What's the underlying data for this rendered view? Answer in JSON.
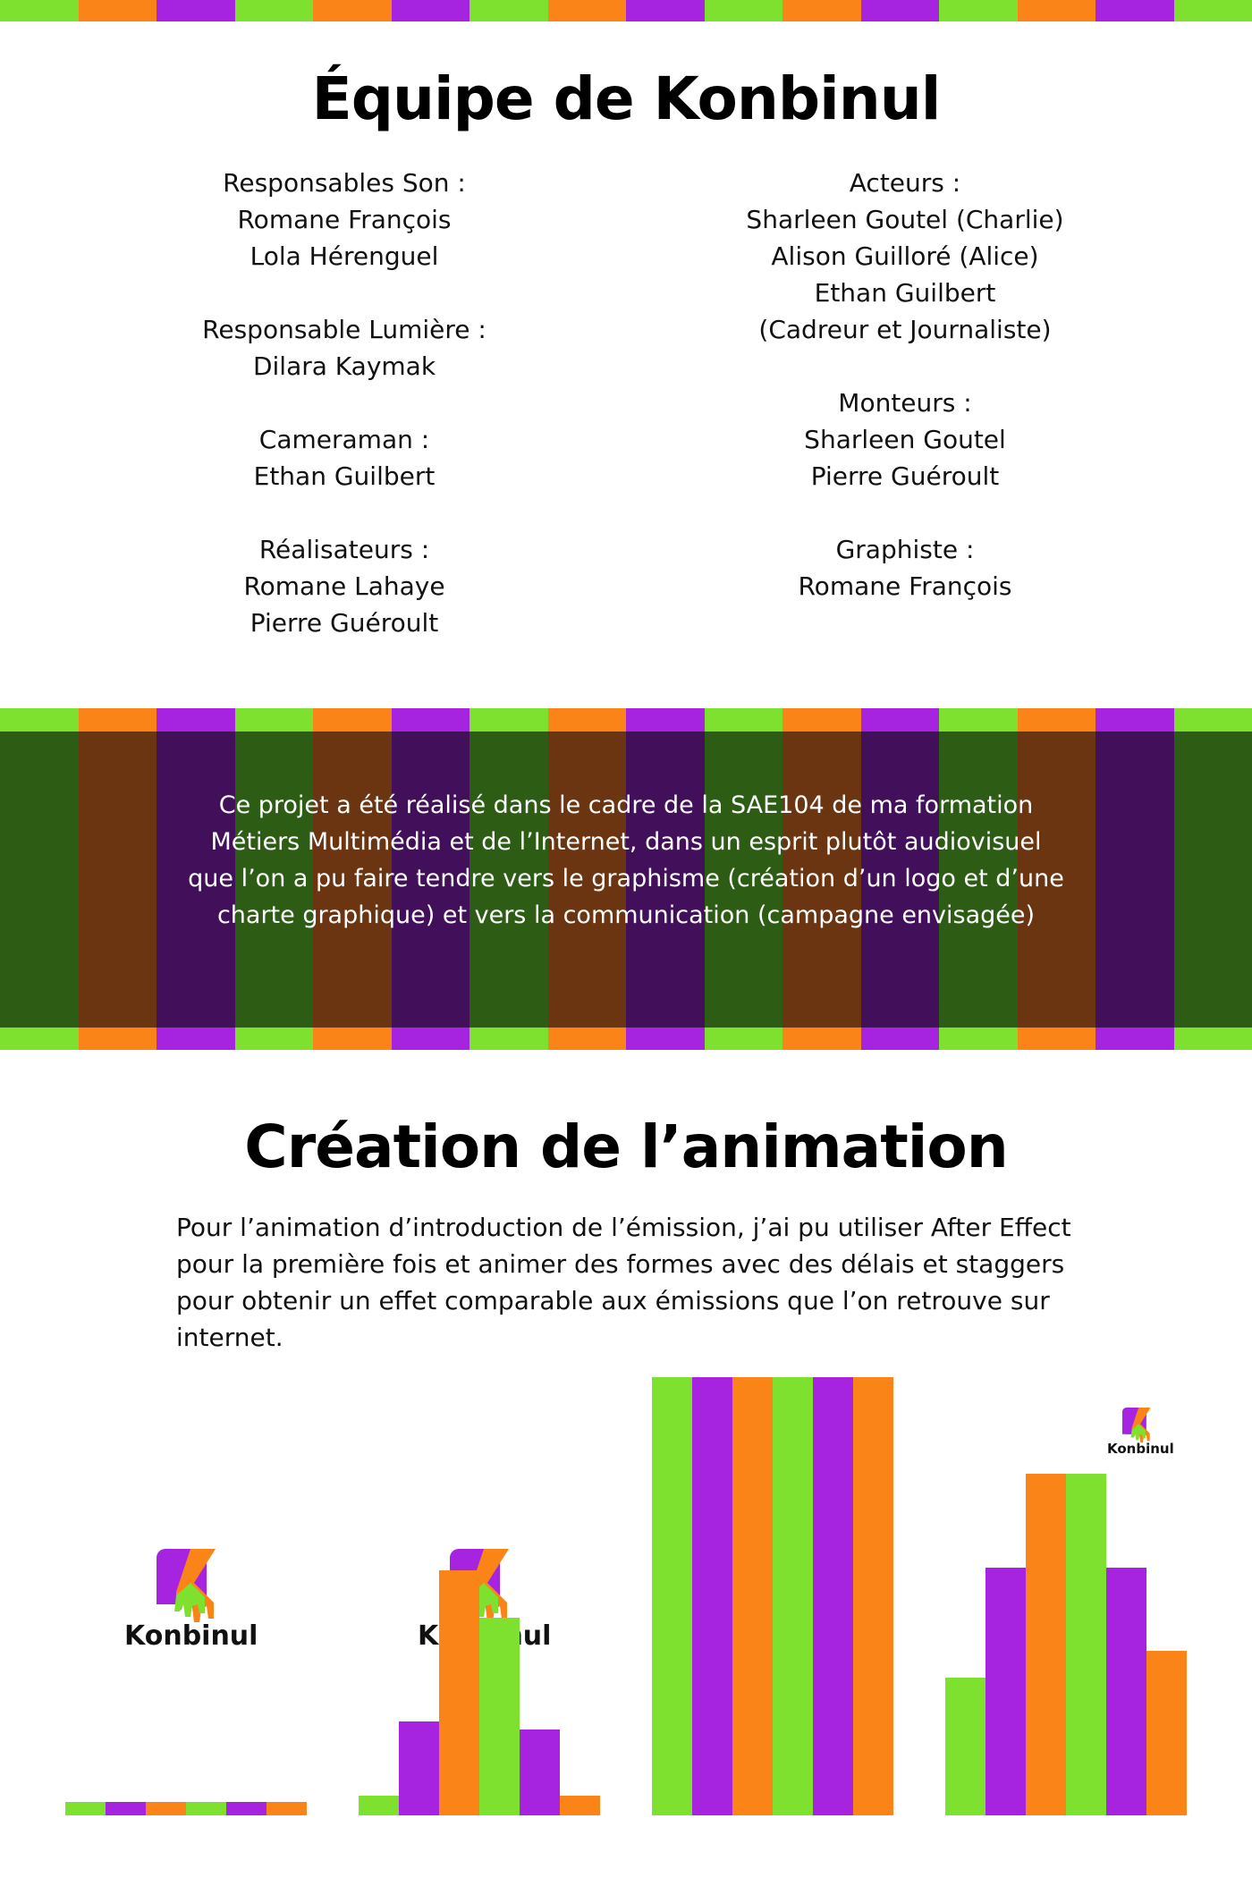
{
  "colors": {
    "green": "#7ee12f",
    "orange": "#fb8418",
    "purple": "#a623e0",
    "dark_green": "#2d5d15",
    "dark_orange": "#6a3510",
    "dark_purple": "#420f5a"
  },
  "stripe_pattern": [
    "green",
    "orange",
    "purple",
    "green",
    "orange",
    "purple",
    "green",
    "orange",
    "purple",
    "green",
    "orange",
    "purple",
    "green",
    "orange",
    "purple",
    "green"
  ],
  "team": {
    "title": "Équipe de Konbinul",
    "left": [
      {
        "role": "Responsables Son :",
        "names": [
          "Romane François",
          "Lola Hérenguel"
        ]
      },
      {
        "role": "Responsable Lumière :",
        "names": [
          "Dilara Kaymak"
        ]
      },
      {
        "role": "Cameraman :",
        "names": [
          "Ethan Guilbert"
        ]
      },
      {
        "role": "Réalisateurs :",
        "names": [
          "Romane Lahaye",
          "Pierre Guéroult"
        ]
      }
    ],
    "right": [
      {
        "role": "Acteurs :",
        "names": [
          "Sharleen Goutel (Charlie)",
          "Alison Guilloré (Alice)",
          "Ethan Guilbert (Cadreur et Journaliste)"
        ]
      },
      {
        "role": "Monteurs :",
        "names": [
          "Sharleen Goutel",
          "Pierre Guéroult"
        ]
      },
      {
        "role": "Graphiste :",
        "names": [
          "Romane François"
        ]
      }
    ]
  },
  "band_text": "Ce projet a été réalisé dans le cadre de la SAE104 de ma formation Métiers Multimédia et de l’Internet, dans un esprit plutôt audiovisuel que l’on a pu faire tendre vers le graphisme (création d’un logo et d’une charte graphique) et vers la communication (campagne envisagée)",
  "animation": {
    "title": "Création de l’animation",
    "text": "Pour l’animation d’introduction de l’émission, j’ai pu utiliser After Effect pour la première fois et animer des formes avec des délais et staggers pour obtenir un effet comparable aux émissions que l’on retrouve sur internet.",
    "logo_text": "Konbinul",
    "bar_colors": [
      "green",
      "purple",
      "orange",
      "green",
      "purple",
      "orange"
    ],
    "frames": [
      {
        "levels": [
          0.03,
          0.03,
          0.03,
          0.03,
          0.03,
          0.03
        ],
        "logo": "large"
      },
      {
        "levels": [
          0.045,
          0.215,
          0.56,
          0.45,
          0.195,
          0.045
        ],
        "logo": "large"
      },
      {
        "levels": [
          1.0,
          1.0,
          1.0,
          1.0,
          1.0,
          1.0
        ],
        "logo": "none"
      },
      {
        "levels": [
          0.315,
          0.565,
          0.78,
          0.78,
          0.565,
          0.375
        ],
        "logo": "small"
      }
    ]
  }
}
